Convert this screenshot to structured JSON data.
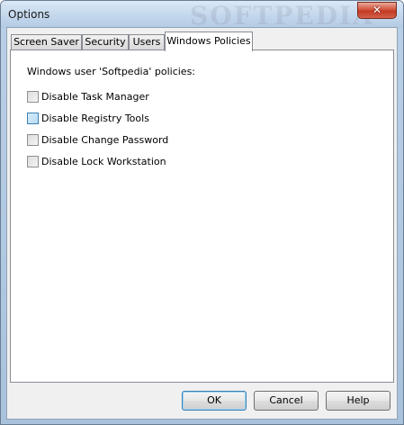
{
  "window": {
    "title": "Options",
    "watermark": "SOFTPEDIA",
    "close_glyph": "✕"
  },
  "tabs": [
    {
      "label": "Screen Saver",
      "active": false
    },
    {
      "label": "Security",
      "active": false
    },
    {
      "label": "Users",
      "active": false
    },
    {
      "label": "Windows Policies",
      "active": true
    }
  ],
  "policies": {
    "heading": "Windows user 'Softpedia' policies:",
    "options": [
      {
        "label": "Disable Task Manager",
        "checked": false
      },
      {
        "label": "Disable Registry Tools",
        "checked": false
      },
      {
        "label": "Disable Change Password",
        "checked": false
      },
      {
        "label": "Disable Lock Workstation",
        "checked": false
      }
    ]
  },
  "buttons": {
    "ok": "OK",
    "cancel": "Cancel",
    "help": "Help"
  }
}
